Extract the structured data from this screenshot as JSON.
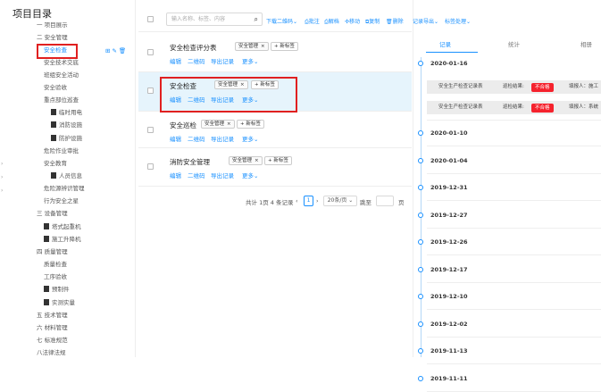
{
  "sidebar": {
    "title": "项目目录",
    "items": [
      {
        "label": "一 项目展示",
        "icon": false
      },
      {
        "label": "二 安全管理",
        "icon": false
      },
      {
        "label": "安全检查",
        "icon": false,
        "active": true
      },
      {
        "label": "安全技术交底",
        "icon": false
      },
      {
        "label": "班组安全活动",
        "icon": false
      },
      {
        "label": "安全验收",
        "icon": false
      },
      {
        "label": "重点部位巡查",
        "icon": false
      },
      {
        "label": "临时用电",
        "icon": true
      },
      {
        "label": "消防设施",
        "icon": true
      },
      {
        "label": "防护设施",
        "icon": true
      },
      {
        "label": "危险作业审批",
        "icon": false
      },
      {
        "label": "安全教育",
        "icon": false
      },
      {
        "label": "人员信息",
        "icon": true
      },
      {
        "label": "危险源辨识管理",
        "icon": false
      },
      {
        "label": "行为安全之星",
        "icon": false
      },
      {
        "label": "三 设备管理",
        "icon": false
      },
      {
        "label": "塔式起重机",
        "icon": true
      },
      {
        "label": "施工升降机",
        "icon": true
      },
      {
        "label": "四 质量管理",
        "icon": false
      },
      {
        "label": "质量检查",
        "icon": false
      },
      {
        "label": "工序验收",
        "icon": false
      },
      {
        "label": "预制件",
        "icon": true
      },
      {
        "label": "实测实量",
        "icon": true
      },
      {
        "label": "五 技术管理",
        "icon": false
      },
      {
        "label": "六 材料管理",
        "icon": false
      },
      {
        "label": "七 标准规范",
        "icon": false
      },
      {
        "label": "八法律法规",
        "icon": false
      }
    ],
    "tools": "⊞✎🗑"
  },
  "toolbar": {
    "search_placeholder": "输入名称、标签、内容",
    "links": [
      "下载二维码⌄",
      "⎙批注",
      "⎙解档",
      "✣移动",
      "⧉复制",
      "🗑删除",
      "记录导出⌄",
      "标签处理⌄"
    ]
  },
  "rows": [
    {
      "title": "安全检查评分表",
      "tags": [
        "安全管理"
      ],
      "add_tag": "+ 新标签",
      "actions": [
        "编辑",
        "二维码",
        "导出记录",
        "更多⌄"
      ]
    },
    {
      "title": "安全检查",
      "tags": [
        "安全管理"
      ],
      "add_tag": "+ 新标签",
      "actions": [
        "编辑",
        "二维码",
        "导出记录",
        "更多⌄"
      ]
    },
    {
      "title": "安全巡检",
      "tags": [
        "安全管理"
      ],
      "add_tag": "+ 新标签",
      "actions": [
        "编辑",
        "二维码",
        "导出记录",
        "更多⌄"
      ]
    },
    {
      "title": "消防安全管理",
      "tags": [
        "安全管理"
      ],
      "add_tag": "+ 新标签",
      "actions": [
        "编辑",
        "二维码",
        "导出记录",
        "更多⌄"
      ]
    }
  ],
  "tag_close": "×",
  "pager": {
    "summary": "共计 1页 4 条记录",
    "prev": "‹",
    "page": "1",
    "next": "›",
    "per_page": "20条/页 ⌄",
    "goto": "跳至",
    "page_suffix": "页"
  },
  "right": {
    "tabs": [
      "记录",
      "统计",
      "相册"
    ],
    "timeline": [
      {
        "date": "2020-01-16",
        "records": [
          {
            "name": "安全生产检查记录表",
            "result_label": "巡检结果:",
            "result": "不合格",
            "reporter": "填报人：施工"
          },
          {
            "name": "安全生产检查记录表",
            "result_label": "巡检结果:",
            "result": "不合格",
            "reporter": "填报人：系统"
          }
        ]
      },
      {
        "date": "2020-01-10",
        "records": []
      },
      {
        "date": "2020-01-04",
        "records": []
      },
      {
        "date": "2019-12-31",
        "records": []
      },
      {
        "date": "2019-12-27",
        "records": []
      },
      {
        "date": "2019-12-26",
        "records": []
      },
      {
        "date": "2019-12-17",
        "records": []
      },
      {
        "date": "2019-12-10",
        "records": []
      },
      {
        "date": "2019-12-02",
        "records": []
      },
      {
        "date": "2019-11-13",
        "records": []
      },
      {
        "date": "2019-11-11",
        "records": []
      }
    ]
  },
  "colors": {
    "accent": "#1890ff",
    "danger": "#f5222d",
    "highlight_row": "#e6f4fc"
  }
}
